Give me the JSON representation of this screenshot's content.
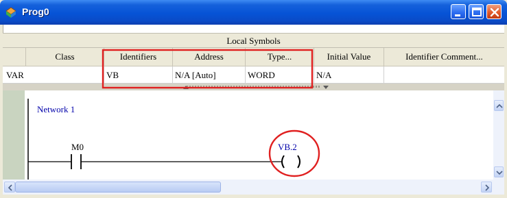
{
  "window": {
    "title": "Prog0"
  },
  "symbols": {
    "banner": "Local Symbols",
    "columns": [
      "Class",
      "Identifiers",
      "Address",
      "Type...",
      "Initial Value",
      "Identifier Comment..."
    ],
    "row": {
      "class": "VAR",
      "identifier": "VB",
      "address": "N/A [Auto]",
      "type": "WORD",
      "initial_value": "N/A",
      "comment": ""
    }
  },
  "ladder": {
    "network_label": "Network 1",
    "contact_operand": "M0",
    "coil_operand": "VB.2"
  },
  "highlight_color": "#e02020",
  "icons": [
    "app-icon",
    "minimize-icon",
    "maximize-icon",
    "close-icon",
    "scroll-up-icon",
    "scroll-down-icon",
    "scroll-left-icon",
    "scroll-right-icon"
  ]
}
